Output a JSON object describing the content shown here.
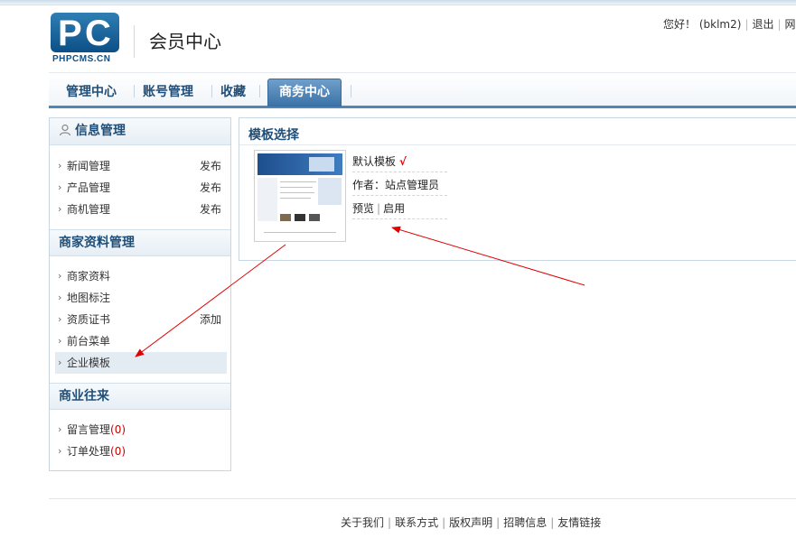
{
  "header": {
    "logo_text": "PHPCMS.CN",
    "logo_mark": [
      "P",
      "C"
    ],
    "site_title": "会员中心",
    "greeting": "您好！",
    "username": "(bklm2)",
    "logout": "退出",
    "truncated_link": "网"
  },
  "nav": {
    "tabs": [
      "管理中心",
      "账号管理",
      "收藏"
    ],
    "active": "商务中心"
  },
  "sidebar": {
    "sections": [
      {
        "title": "信息管理",
        "items": [
          {
            "label": "新闻管理",
            "action": "发布"
          },
          {
            "label": "产品管理",
            "action": "发布"
          },
          {
            "label": "商机管理",
            "action": "发布"
          }
        ]
      },
      {
        "title": "商家资料管理",
        "items": [
          {
            "label": "商家资料",
            "action": ""
          },
          {
            "label": "地图标注",
            "action": ""
          },
          {
            "label": "资质证书",
            "action": "添加"
          },
          {
            "label": "前台菜单",
            "action": ""
          },
          {
            "label": "企业模板",
            "action": ""
          }
        ]
      },
      {
        "title": "商业往来",
        "items": [
          {
            "label": "留言管理",
            "count": "0"
          },
          {
            "label": "订单处理",
            "count": "0"
          }
        ]
      }
    ]
  },
  "panel": {
    "title": "模板选择",
    "template_name": "默认模板",
    "check_mark": "√",
    "author": "作者：站点管理员",
    "preview": "预览",
    "enable": "启用"
  },
  "footer": {
    "links": [
      "关于我们",
      "联系方式",
      "版权声明",
      "招聘信息",
      "友情链接"
    ]
  },
  "colors": {
    "brand": "#1f4e79",
    "accent": "#4f86b7",
    "arrow": "#e00000"
  }
}
